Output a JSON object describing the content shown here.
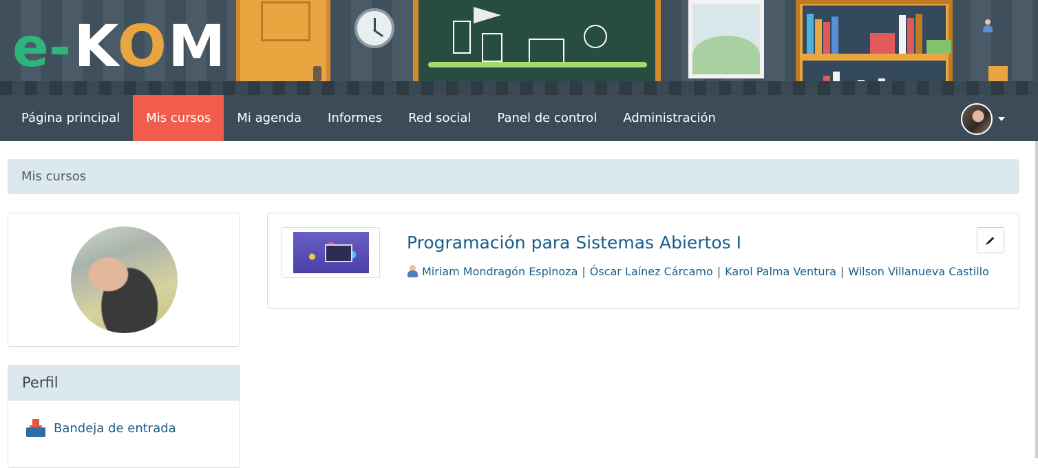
{
  "logo": {
    "part1": "e-",
    "part2a": "K",
    "part2b": "O",
    "part2c": "M"
  },
  "nav": {
    "items": [
      {
        "label": "Página principal",
        "active": false
      },
      {
        "label": "Mis cursos",
        "active": true
      },
      {
        "label": "Mi agenda",
        "active": false
      },
      {
        "label": "Informes",
        "active": false
      },
      {
        "label": "Red social",
        "active": false
      },
      {
        "label": "Panel de control",
        "active": false
      },
      {
        "label": "Administración",
        "active": false
      }
    ],
    "active_color": "#f05d4d",
    "bar_color": "#3d4b58"
  },
  "breadcrumb": {
    "current": "Mis cursos"
  },
  "profile_block": {
    "title": "Perfil",
    "items": [
      {
        "label": "Bandeja de entrada",
        "icon": "inbox-icon"
      }
    ]
  },
  "course": {
    "title": "Programación para Sistemas Abiertos I",
    "teachers": [
      "Miriam Mondragón Espinoza",
      "Óscar Laínez Cárcamo",
      "Karol Palma Ventura",
      "Wilson Villanueva Castillo"
    ],
    "separator": "|",
    "edit_icon": "pencil-icon"
  },
  "colors": {
    "link": "#1a5f8a",
    "breadcrumb_bg": "#dbe9ee"
  }
}
